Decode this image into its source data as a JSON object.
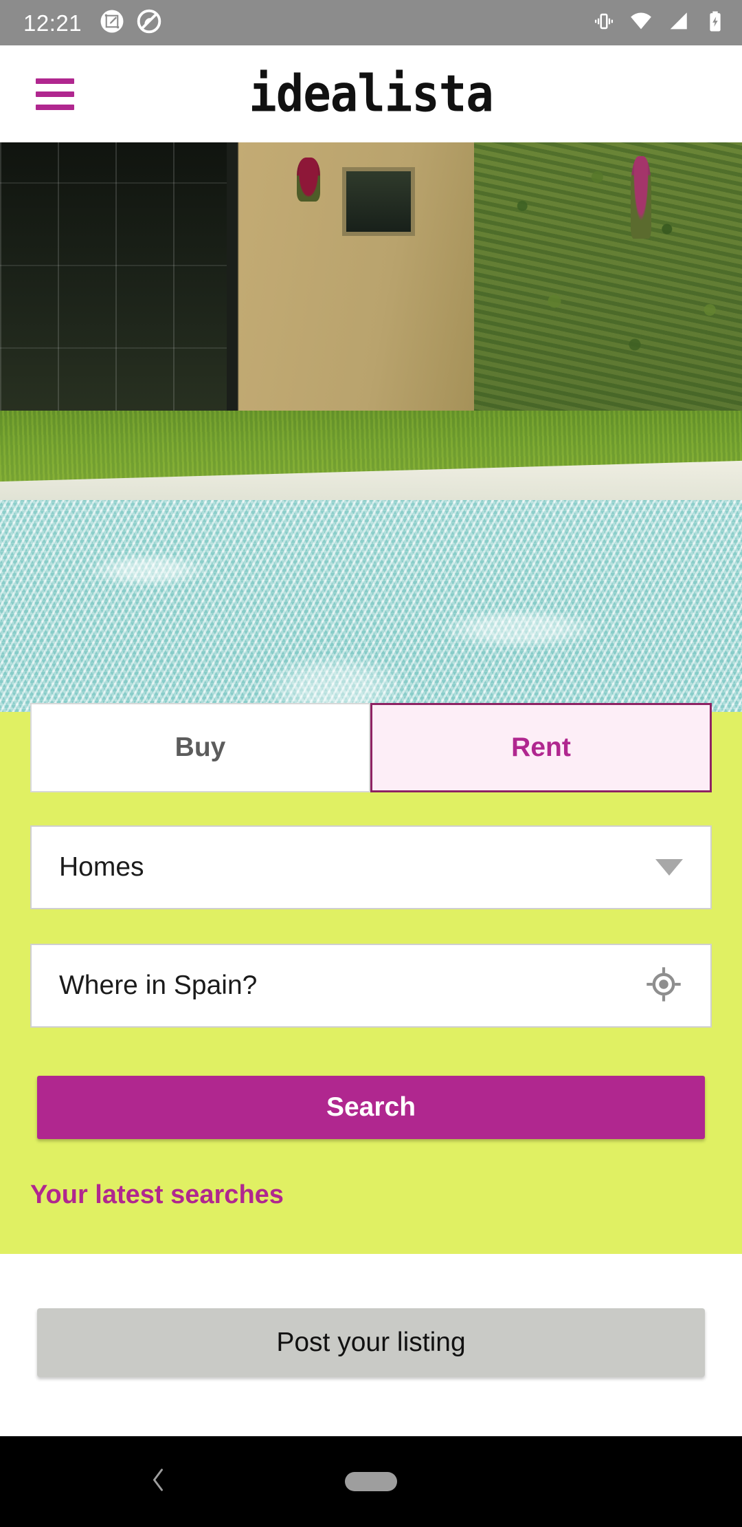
{
  "status_bar": {
    "time": "12:21",
    "left_icons": [
      {
        "name": "screenshot-edit-icon"
      },
      {
        "name": "do-not-disturb-icon"
      }
    ],
    "right_icons": [
      {
        "name": "vibrate-mode-icon"
      },
      {
        "name": "wifi-icon"
      },
      {
        "name": "cellular-signal-icon"
      },
      {
        "name": "battery-charging-icon"
      }
    ],
    "background": "#8c8c8c"
  },
  "header": {
    "menu_icon": "hamburger-menu-icon",
    "brand": "idealista",
    "brand_color": "#111111",
    "accent_color": "#b0278f"
  },
  "hero": {
    "alt": "villa exterior with lawn and swimming pool"
  },
  "search_panel": {
    "background": "#e0f063",
    "tabs": [
      {
        "label": "Buy",
        "active": false
      },
      {
        "label": "Rent",
        "active": true
      }
    ],
    "property_type": {
      "value": "Homes",
      "caret_icon": "chevron-down-icon"
    },
    "location": {
      "placeholder": "Where in Spain?",
      "value": "Where in Spain?",
      "locate_icon": "my-location-icon"
    },
    "search_button": {
      "label": "Search",
      "color": "#b0278f",
      "text_color": "#ffffff"
    },
    "latest_searches_title": "Your latest searches"
  },
  "footer": {
    "post_listing_button": {
      "label": "Post your listing",
      "color": "#c9cac6",
      "text_color": "#111111"
    }
  },
  "nav_bar": {
    "background": "#000000",
    "back_icon": "back-chevron-icon",
    "home_indicator": "home-pill-indicator"
  }
}
